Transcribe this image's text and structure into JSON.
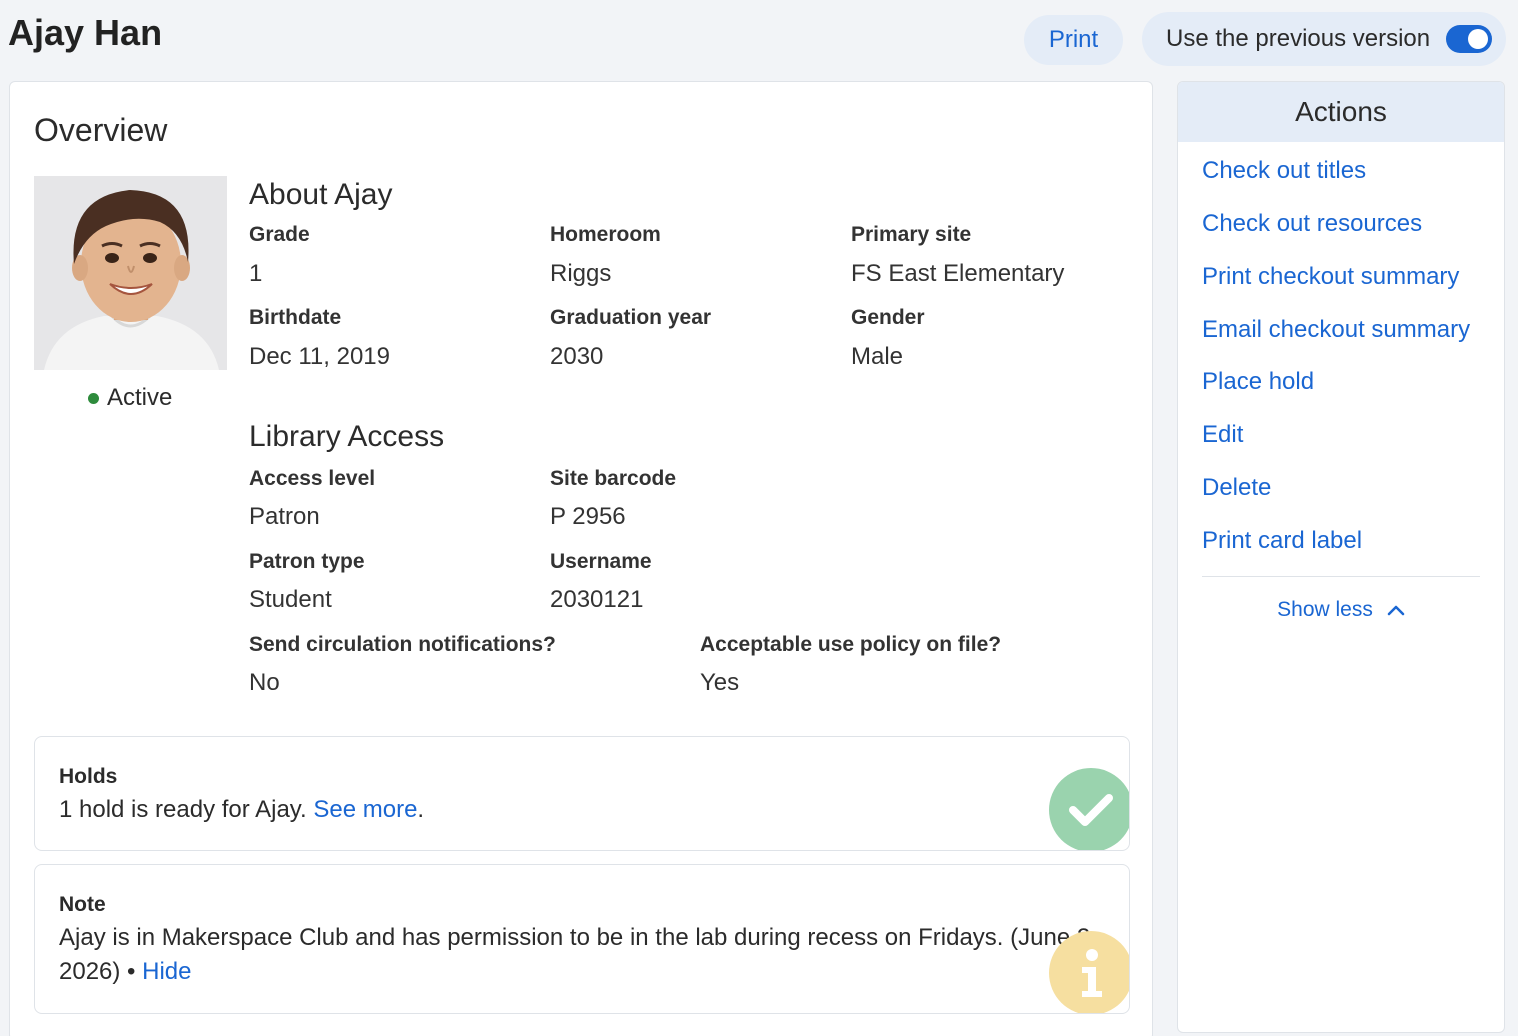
{
  "header": {
    "title": "Ajay Han",
    "print_label": "Print",
    "version_toggle_label": "Use the previous version",
    "version_toggle_on": true
  },
  "overview": {
    "title": "Overview",
    "status": "Active",
    "about": {
      "title": "About Ajay",
      "fields": [
        {
          "label": "Grade",
          "value": "1"
        },
        {
          "label": "Homeroom",
          "value": "Riggs"
        },
        {
          "label": "Primary site",
          "value": "FS East Elementary"
        },
        {
          "label": "Birthdate",
          "value": "Dec 11, 2019"
        },
        {
          "label": "Graduation year",
          "value": "2030"
        },
        {
          "label": "Gender",
          "value": "Male"
        }
      ]
    },
    "library": {
      "title": "Library Access",
      "fields": [
        {
          "label": "Access level",
          "value": "Patron"
        },
        {
          "label": "Site barcode",
          "value": "P 2956"
        },
        {
          "label": "Patron type",
          "value": "Student"
        },
        {
          "label": "Username",
          "value": "2030121"
        },
        {
          "label": "Send circulation notifications?",
          "value": "No"
        },
        {
          "label": "Acceptable use policy on file?",
          "value": "Yes"
        }
      ]
    },
    "holds": {
      "title": "Holds",
      "text": "1 hold is ready for Ajay.",
      "link": "See more",
      "suffix": "."
    },
    "note": {
      "title": "Note",
      "text_line1": "Ajay is in Makerspace Club and has permission to be in the lab during recess on Fridays. (June 2,",
      "text_line2": "2026) •",
      "link": "Hide"
    }
  },
  "actions": {
    "title": "Actions",
    "items": [
      "Check out titles",
      "Check out resources",
      "Print checkout summary",
      "Email checkout summary",
      "Place hold",
      "Edit",
      "Delete",
      "Print card label"
    ],
    "show_less": "Show less"
  },
  "colors": {
    "accent": "#1a66d2",
    "status_active": "#2e8b3c",
    "success_badge": "#9ad3ae",
    "info_badge": "#f6dfa0"
  }
}
